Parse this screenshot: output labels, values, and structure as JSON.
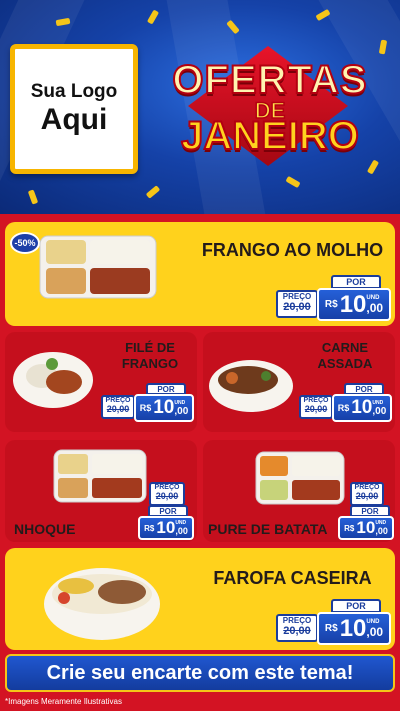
{
  "header": {
    "logo_line1": "Sua Logo",
    "logo_line2": "Aqui",
    "title_line1": "OFERTAS",
    "title_line2": "DE",
    "title_line3": "JANEIRO"
  },
  "labels": {
    "before": "PREÇO",
    "now": "POR",
    "currency": "R$",
    "unit": "UND"
  },
  "products": [
    {
      "name": "FRANGO AO MOLHO",
      "old_price": "20,00",
      "price_int": "10",
      "price_dec": ",00",
      "discount": "-50%"
    },
    {
      "name_line1": "FILÉ DE",
      "name_line2": "FRANGO",
      "old_price": "20,00",
      "price_int": "10",
      "price_dec": ",00"
    },
    {
      "name_line1": "CARNE",
      "name_line2": "ASSADA",
      "old_price": "20,00",
      "price_int": "10",
      "price_dec": ",00"
    },
    {
      "name": "NHOQUE",
      "old_price": "20,00",
      "price_int": "10",
      "price_dec": ",00"
    },
    {
      "name": "PURE DE BATATA",
      "old_price": "20,00",
      "price_int": "10",
      "price_dec": ",00"
    },
    {
      "name": "FAROFA CASEIRA",
      "old_price": "20,00",
      "price_int": "10",
      "price_dec": ",00"
    }
  ],
  "footer": {
    "cta": "Crie seu encarte com este tema!",
    "disclaimer": "*Imagens Meramente Ilustrativas"
  },
  "colors": {
    "red": "#d31323",
    "yellow": "#ffd21c",
    "blue": "#1b3d9c"
  }
}
